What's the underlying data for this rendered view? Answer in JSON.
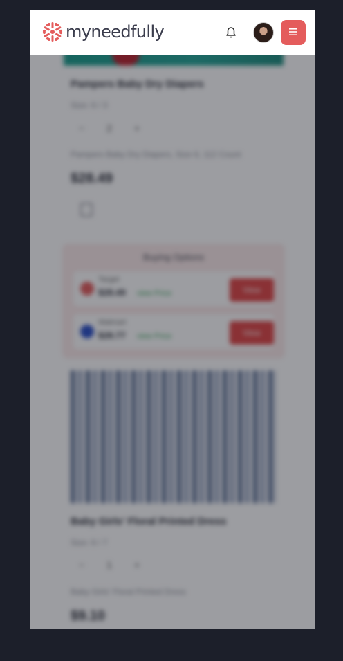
{
  "header": {
    "logo_text": "myneedfully",
    "brand_color": "#e45c5c",
    "icons": [
      "snowflake-logo-icon",
      "bell-icon",
      "hamburger-menu-icon"
    ]
  },
  "items": [
    {
      "title": "Pampers Baby Dry Diapers",
      "size": "Size: 6 / 3",
      "quantity": "2",
      "minus": "−",
      "plus": "+",
      "description": "Pampers Baby Dry Diapers, Size 6, 112 Count",
      "price": "$28.49"
    },
    {
      "title": "Baby Girls' Floral Printed Dress",
      "size": "Size: 6 / 7",
      "quantity": "1",
      "minus": "−",
      "plus": "+",
      "description": "Baby Girls' Floral Printed Dress",
      "price": "$9.10"
    }
  ],
  "buying_options": {
    "title": "Buying Options",
    "options": [
      {
        "store": "Target",
        "price": "$28.49",
        "link": "view Price",
        "button": "View",
        "color": "#e45c5c"
      },
      {
        "store": "Walmart",
        "price": "$28.77",
        "link": "view Price",
        "button": "View",
        "color": "#2a4fc8"
      }
    ]
  }
}
